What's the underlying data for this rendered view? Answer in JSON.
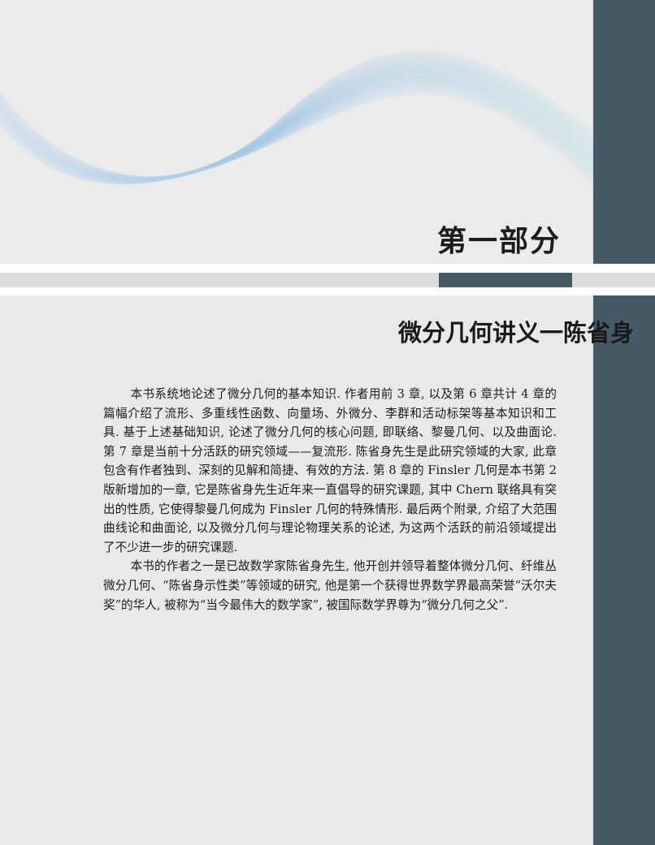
{
  "header": {
    "part_title": "第一部分"
  },
  "book": {
    "title": "微分几何讲义一陈省身",
    "paragraphs": [
      "本书系统地论述了微分几何的基本知识. 作者用前 3 章, 以及第 6 章共计 4 章的篇幅介绍了流形、多重线性函数、向量场、外微分、李群和活动标架等基本知识和工具. 基于上述基础知识, 论述了微分几何的核心问题, 即联络、黎曼几何、以及曲面论. 第 7 章是当前十分活跃的研究领域——复流形. 陈省身先生是此研究领域的大家, 此章包含有作者独到、深刻的见解和简捷、有效的方法. 第 8 章的 Finsler 几何是本书第 2 版新增加的一章, 它是陈省身先生近年来一直倡导的研究课题, 其中 Chern 联络具有突出的性质, 它使得黎曼几何成为 Finsler 几何的特殊情形. 最后两个附录, 介绍了大范围曲线论和曲面论, 以及微分几何与理论物理关系的论述, 为这两个活跃的前沿领域提出了不少进一步的研究课题.",
      "本书的作者之一是已故数学家陈省身先生, 他开创并领导着整体微分几何、纤维丛微分几何、“陈省身示性类”等领域的研究, 他是第一个获得世界数学界最高荣誉“沃尔夫奖”的华人, 被称为“当今最伟大的数学家”, 被国际数学界尊为“微分几何之父”."
    ]
  },
  "colors": {
    "accent": "#465a66",
    "panel": "#e9e9eb",
    "wave": "#8fb8da"
  },
  "decoration": {
    "icon": "wave-ribbon-decoration"
  }
}
